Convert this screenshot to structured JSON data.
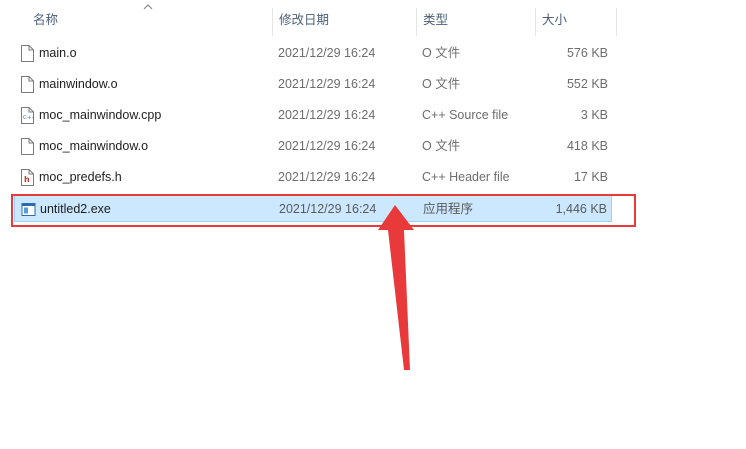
{
  "columns": {
    "name": "名称",
    "date": "修改日期",
    "type": "类型",
    "size": "大小"
  },
  "files": [
    {
      "name": "main.o",
      "date": "2021/12/29 16:24",
      "type": "O 文件",
      "size": "576 KB",
      "icon": "blank-file-icon",
      "selected": false
    },
    {
      "name": "mainwindow.o",
      "date": "2021/12/29 16:24",
      "type": "O 文件",
      "size": "552 KB",
      "icon": "blank-file-icon",
      "selected": false
    },
    {
      "name": "moc_mainwindow.cpp",
      "date": "2021/12/29 16:24",
      "type": "C++ Source file",
      "size": "3 KB",
      "icon": "cpp-file-icon",
      "selected": false
    },
    {
      "name": "moc_mainwindow.o",
      "date": "2021/12/29 16:24",
      "type": "O 文件",
      "size": "418 KB",
      "icon": "blank-file-icon",
      "selected": false
    },
    {
      "name": "moc_predefs.h",
      "date": "2021/12/29 16:24",
      "type": "C++ Header file",
      "size": "17 KB",
      "icon": "header-file-icon",
      "selected": false
    },
    {
      "name": "untitled2.exe",
      "date": "2021/12/29 16:24",
      "type": "应用程序",
      "size": "1,446 KB",
      "icon": "exe-file-icon",
      "selected": true
    }
  ],
  "colors": {
    "selection_bg": "#cce8ff",
    "selection_border": "#99d1ff",
    "annotation_red": "#e8393b",
    "header_text": "#4c607a"
  }
}
